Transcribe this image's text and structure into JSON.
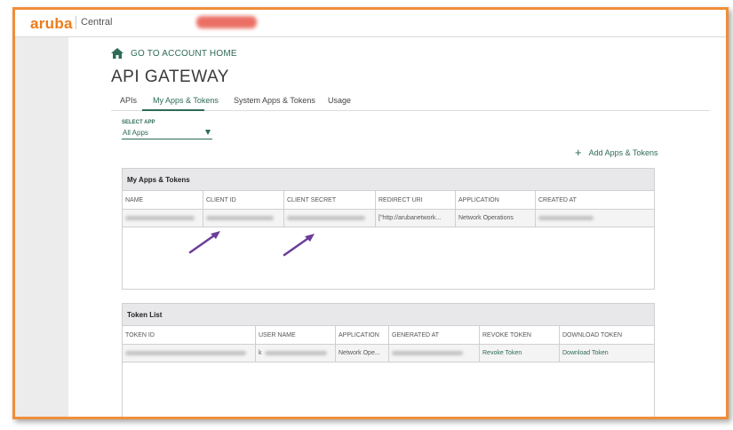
{
  "header": {
    "logo": "aruba",
    "product": "Central"
  },
  "nav": {
    "home_label": "GO TO ACCOUNT HOME"
  },
  "page": {
    "title": "API GATEWAY"
  },
  "tabs": [
    {
      "label": "APIs",
      "active": false
    },
    {
      "label": "My Apps & Tokens",
      "active": true
    },
    {
      "label": "System Apps & Tokens",
      "active": false
    },
    {
      "label": "Usage",
      "active": false
    }
  ],
  "select_app": {
    "label": "SELECT APP",
    "value": "All Apps"
  },
  "add_button": {
    "icon": "+",
    "label": "Add Apps & Tokens"
  },
  "apps_panel": {
    "title": "My Apps & Tokens",
    "columns": [
      "NAME",
      "CLIENT ID",
      "CLIENT SECRET",
      "REDIRECT URI",
      "APPLICATION",
      "CREATED AT"
    ],
    "rows": [
      {
        "name": "",
        "client_id": "",
        "client_secret": "",
        "redirect_uri": "[\"http://arubanetwork...",
        "application": "Network Operations",
        "created_at": ""
      }
    ]
  },
  "token_panel": {
    "title": "Token List",
    "columns": [
      "TOKEN ID",
      "USER NAME",
      "APPLICATION",
      "GENERATED AT",
      "REVOKE TOKEN",
      "DOWNLOAD TOKEN"
    ],
    "rows": [
      {
        "token_id": "",
        "user_name": "k",
        "application": "Network Ope...",
        "generated_at": "",
        "revoke": "Revoke Token",
        "download": "Download Token"
      }
    ]
  },
  "colors": {
    "brand_orange": "#ef7a1a",
    "accent_green": "#2d6b55",
    "annotation_purple": "#6a3d9a",
    "frame_border": "#ef8e3a"
  }
}
